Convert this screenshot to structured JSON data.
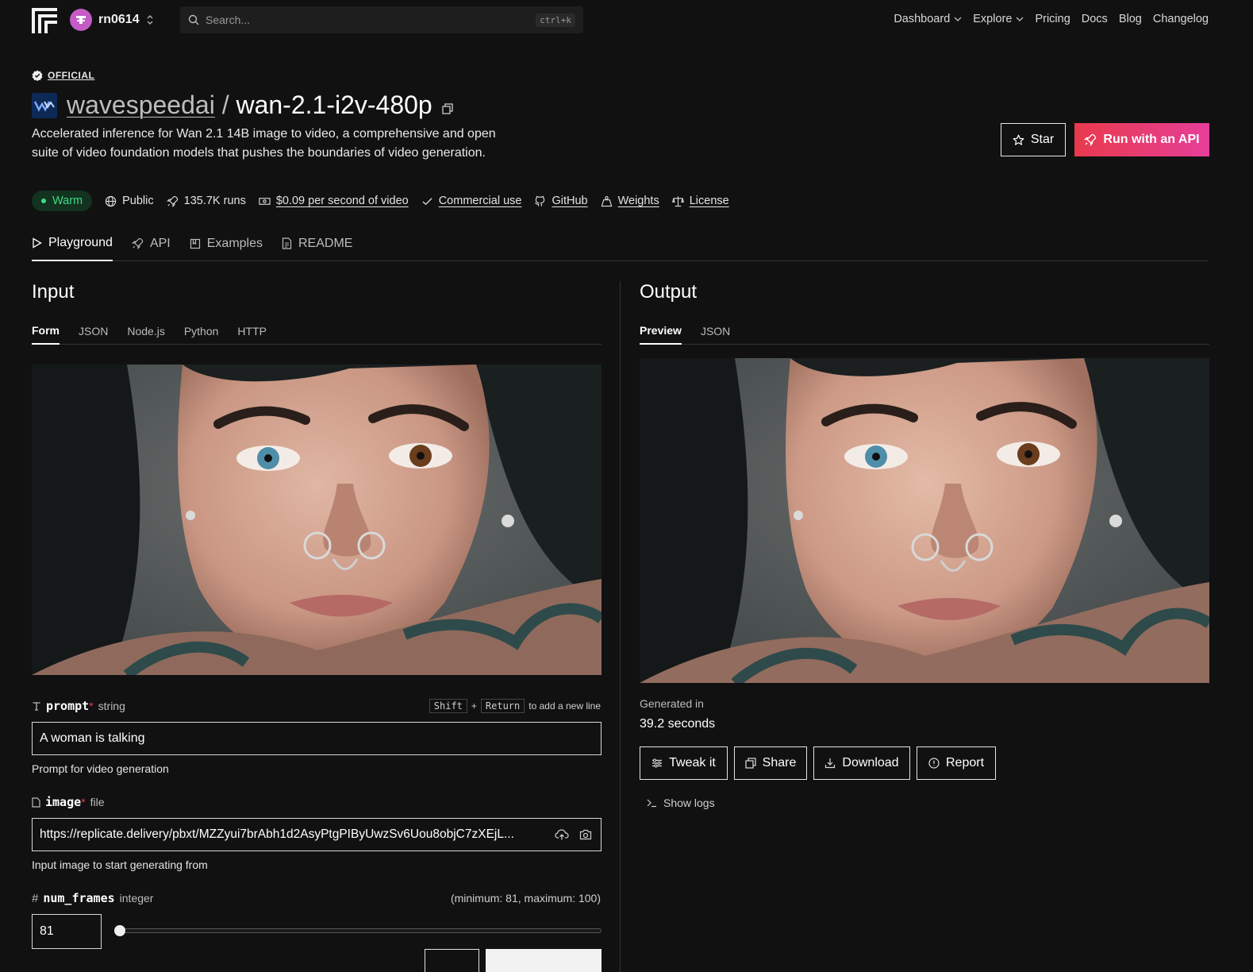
{
  "nav": {
    "account": "rn0614",
    "search_placeholder": "Search...",
    "search_shortcut": "ctrl+k",
    "links": [
      "Dashboard",
      "Explore",
      "Pricing",
      "Docs",
      "Blog",
      "Changelog"
    ]
  },
  "model": {
    "badge": "OFFICIAL",
    "owner": "wavespeedai",
    "separator": "/",
    "name": "wan-2.1-i2v-480p",
    "description": "Accelerated inference for Wan 2.1 14B image to video, a comprehensive and open suite of video foundation models that pushes the boundaries of video generation.",
    "star_label": "Star",
    "api_label": "Run with an API"
  },
  "meta": {
    "status": "Warm",
    "visibility": "Public",
    "runs": "135.7K runs",
    "price": "$0.09 per second of video",
    "commercial": "Commercial use",
    "github": "GitHub",
    "weights": "Weights",
    "license": "License"
  },
  "tabs": [
    "Playground",
    "API",
    "Examples",
    "README"
  ],
  "input": {
    "title": "Input",
    "subtabs": [
      "Form",
      "JSON",
      "Node.js",
      "Python",
      "HTTP"
    ],
    "prompt": {
      "name": "prompt",
      "required_mark": "*",
      "type": "string",
      "hint_key1": "Shift",
      "hint_plus": "+",
      "hint_key2": "Return",
      "hint_text": "to add a new line",
      "value": "A woman is talking",
      "help": "Prompt for video generation"
    },
    "image": {
      "name": "image",
      "required_mark": "*",
      "type": "file",
      "value": "https://replicate.delivery/pbxt/MZZyui7brAbh1d2AsyPtgPIByUwzSv6Uou8objC7zXEjL...",
      "help": "Input image to start generating from"
    },
    "num_frames": {
      "name": "num_frames",
      "type": "integer",
      "range": "(minimum: 81, maximum: 100)",
      "value": "81",
      "minimum": 81,
      "maximum": 100
    }
  },
  "output": {
    "title": "Output",
    "subtabs": [
      "Preview",
      "JSON"
    ],
    "generated_label": "Generated in",
    "generated_value": "39.2 seconds",
    "buttons": [
      "Tweak it",
      "Share",
      "Download",
      "Report"
    ],
    "show_logs": "Show logs"
  },
  "colors": {
    "accent_gradient_start": "#e83a4c",
    "accent_gradient_end": "#e63e9a",
    "warm_green": "#3ddc84",
    "background": "#111111"
  }
}
